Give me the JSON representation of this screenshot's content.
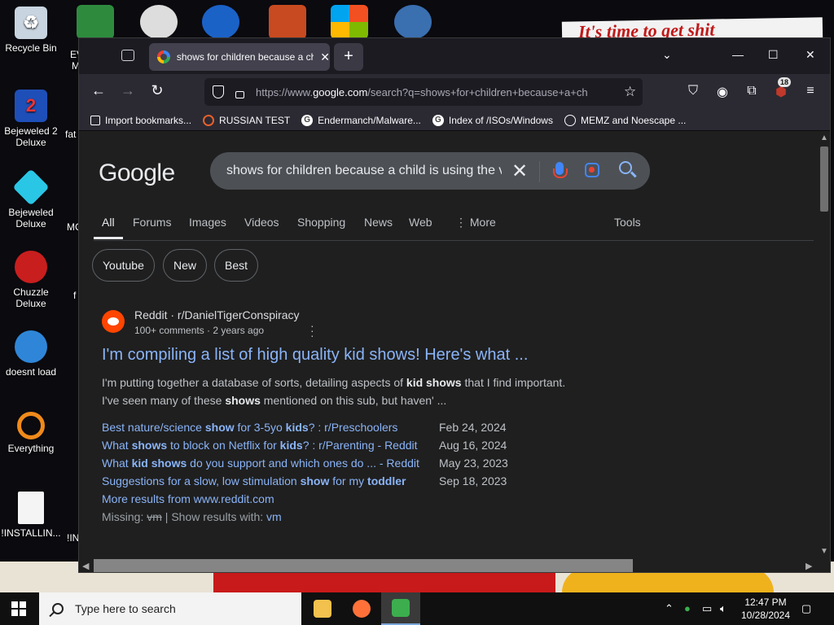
{
  "desktop": {
    "wallpaper_text": "It's time to get shit",
    "icons": [
      {
        "label": "Recycle Bin"
      },
      {
        "label": "Bejeweled 2 Deluxe"
      },
      {
        "label": "Bejeweled Deluxe"
      },
      {
        "label": "Chuzzle Deluxe"
      },
      {
        "label": "doesnt load"
      },
      {
        "label": "Everything"
      },
      {
        "label": "!INSTALLIN..."
      }
    ],
    "partial_labels": [
      "EV",
      "M",
      "fat",
      "MC",
      "f",
      "!IN"
    ]
  },
  "browser": {
    "tab_title": "shows for children because a child is using the vm",
    "new_tab_label": "+",
    "url": "https://www.google.com/search?q=shows+for+children+because+a+child",
    "url_prefix": "https://www.",
    "url_domain": "google.com",
    "url_path": "/search?q=shows+for+children+because+a+ch",
    "extension_badge": "18",
    "bookmarks": [
      {
        "label": "Import bookmarks...",
        "icon": "import-icon"
      },
      {
        "label": "RUSSIAN TEST",
        "icon": "ring-icon"
      },
      {
        "label": "Endermanch/Malware...",
        "icon": "google-icon"
      },
      {
        "label": "Index of /ISOs/Windows",
        "icon": "google-icon"
      },
      {
        "label": "MEMZ and Noescape ...",
        "icon": "globe-icon"
      }
    ]
  },
  "google": {
    "logo": "Google",
    "query": "shows for children because a child is using the vm",
    "tabs": [
      "All",
      "Forums",
      "Images",
      "Videos",
      "Shopping",
      "News",
      "Web",
      "More"
    ],
    "tools": "Tools",
    "chips": [
      "Youtube",
      "New",
      "Best"
    ],
    "result": {
      "site": "Reddit · r/DanielTigerConspiracy",
      "meta": "100+ comments · 2 years ago",
      "title": "I'm compiling a list of high quality kid shows! Here's what ...",
      "snippet_1_a": "I'm putting together a database of sorts, detailing aspects of ",
      "snippet_1_b": "kid shows",
      "snippet_1_c": " that I find important.",
      "snippet_2_a": "I've seen many of these ",
      "snippet_2_b": "shows",
      "snippet_2_c": " mentioned on this sub, but haven' ...",
      "sublinks": [
        {
          "a": "Best nature/science ",
          "b": "show",
          "c": " for 3-5yo ",
          "d": "kids",
          "e": "? : r/Preschoolers",
          "date": "Feb 24, 2024"
        },
        {
          "a": "What ",
          "b": "shows",
          "c": " to block on Netflix for ",
          "d": "kids",
          "e": "? : r/Parenting - Reddit",
          "date": "Aug 16, 2024"
        },
        {
          "a": "What ",
          "b": "kid shows",
          "c": " do you support and which ones do ... - Reddit",
          "d": "",
          "e": "",
          "date": "May 23, 2023"
        },
        {
          "a": "Suggestions for a slow, low stimulation ",
          "b": "show",
          "c": " for my ",
          "d": "toddler",
          "e": "",
          "date": "Sep 18, 2023"
        }
      ],
      "more_results": "More results from www.reddit.com",
      "missing_label": "Missing: ",
      "missing_term": "vm",
      "show_with_label": " | Show results with: ",
      "show_with_term": "vm"
    }
  },
  "taskbar": {
    "search_placeholder": "Type here to search",
    "time": "12:47 PM",
    "date": "10/28/2024"
  }
}
